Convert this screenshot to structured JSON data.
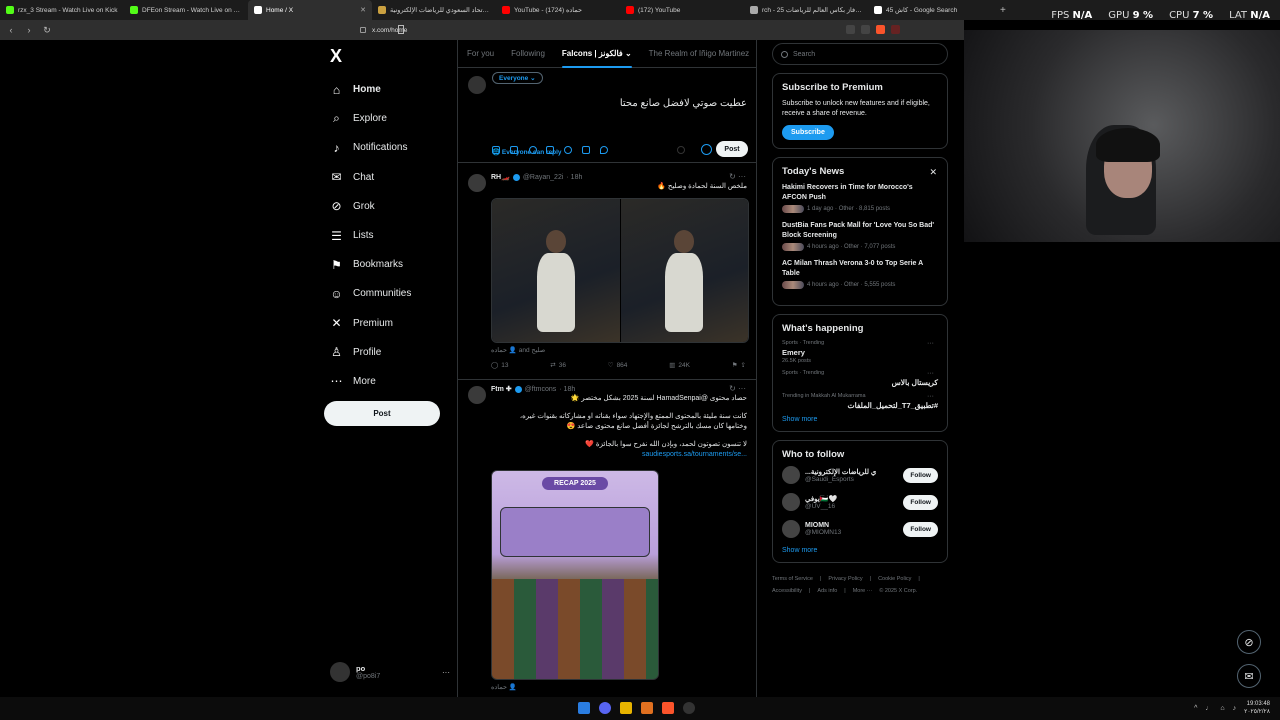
{
  "browser": {
    "tabs": [
      {
        "title": "rzx_3 Stream - Watch Live on Kick",
        "color": "#53fc18",
        "active": false
      },
      {
        "title": "DFEon Stream - Watch Live on Kick",
        "color": "#53fc18",
        "active": false
      },
      {
        "title": "Home / X",
        "color": "#ffffff",
        "active": true
      },
      {
        "title": "جوائز الاتحاد السعودي للرياضات الإلكترونية",
        "color": "#caa040",
        "active": false
      },
      {
        "title": "YouTube - حماده (1724)",
        "color": "#ff0000",
        "active": false
      },
      {
        "title": "(172) YouTube",
        "color": "#ff0000",
        "active": false
      },
      {
        "title": "rch - 25 مين فاز بكاس العالم للرياضات",
        "color": "#aaaaaa",
        "active": false
      },
      {
        "title": "كاش 45 - Google Search",
        "color": "#ffffff",
        "active": false
      }
    ],
    "url": "x.com/home"
  },
  "overlay": {
    "fps_label": "FPS",
    "fps": "N/A",
    "gpu_label": "GPU",
    "gpu": "9 %",
    "cpu_label": "CPU",
    "cpu": "7 %",
    "lat_label": "LAT",
    "lat": "N/A"
  },
  "nav": {
    "logo": "X",
    "items": [
      {
        "label": "Home",
        "icon": "home-icon",
        "glyph": "⌂"
      },
      {
        "label": "Explore",
        "icon": "search-icon",
        "glyph": "⌕"
      },
      {
        "label": "Notifications",
        "icon": "bell-icon",
        "glyph": "♪"
      },
      {
        "label": "Chat",
        "icon": "chat-icon",
        "glyph": "✉"
      },
      {
        "label": "Grok",
        "icon": "grok-icon",
        "glyph": "⊘"
      },
      {
        "label": "Lists",
        "icon": "list-icon",
        "glyph": "☰"
      },
      {
        "label": "Bookmarks",
        "icon": "bookmark-icon",
        "glyph": "⚑"
      },
      {
        "label": "Communities",
        "icon": "communities-icon",
        "glyph": "☺"
      },
      {
        "label": "Premium",
        "icon": "x-premium-icon",
        "glyph": "✕"
      },
      {
        "label": "Profile",
        "icon": "profile-icon",
        "glyph": "♙"
      },
      {
        "label": "More",
        "icon": "more-icon",
        "glyph": "⋯"
      }
    ],
    "post_label": "Post",
    "account": {
      "name": "po",
      "handle": "@po8i7"
    }
  },
  "timeline": {
    "tabs": [
      "For you",
      "Following",
      "Falcons | فالكونز",
      "The Realm of Iñigo Martinez"
    ],
    "composer": {
      "audience": "Everyone ⌄",
      "draft": "عطيت صوتي لافضل صانع محتا",
      "reply_setting": "🌐 Everyone can reply",
      "post_label": "Post"
    },
    "tweets": [
      {
        "name": "RH🏎️",
        "handle": "@Rayan_22i",
        "time": "· 18h",
        "text": "ملخص السنة لحمادة وصليح 🔥",
        "credit": "حماده 👤 and صليح",
        "replies": "13",
        "reposts": "36",
        "likes": "864",
        "views": "24K"
      },
      {
        "name": "Ftm ✚",
        "handle": "@ftmcons",
        "time": "· 18h",
        "lines": [
          "حصاد محتوى @HamadSenpai لسنة 2025 بشكل مختصر 🌟",
          "كانت سنة مليئة بالمحتوى الممتع والإجتهاد سواء بقناته او مشاركاته بقنوات غيره،",
          "وختامها كان مسك بالترشح لجائزة أفضل صانع محتوى صاعد 😍",
          "لا تنسون تصوتون لحمد، وبإذن الله نفرح سوا بالجائزة ❤️"
        ],
        "link": "saudiesports.sa/tournaments/se...",
        "badge": "RECAP 2025",
        "credit": "حماده 👤"
      }
    ]
  },
  "sidebar": {
    "search_placeholder": "Search",
    "premium": {
      "title": "Subscribe to Premium",
      "text": "Subscribe to unlock new features and if eligible, receive a share of revenue.",
      "button": "Subscribe"
    },
    "news": {
      "title": "Today's News",
      "items": [
        {
          "title": "Hakimi Recovers in Time for Morocco's AFCON Push",
          "meta": "1 day ago · Other · 8,815 posts"
        },
        {
          "title": "DustBia Fans Pack Mall for 'Love You So Bad' Block Screening",
          "meta": "4 hours ago · Other · 7,077 posts"
        },
        {
          "title": "AC Milan Thrash Verona 3-0 to Top Serie A Table",
          "meta": "4 hours ago · Other · 5,555 posts"
        }
      ]
    },
    "happening": {
      "title": "What's happening",
      "trends": [
        {
          "context": "Sports · Trending",
          "name": "Emery",
          "posts": "26.5K posts",
          "rtl": false
        },
        {
          "context": "Sports · Trending",
          "name": "كريستال بالاس",
          "posts": "",
          "rtl": true
        },
        {
          "context": "Trending in Makkah Al Mukarrama",
          "name": "#تطبيق_T7_لتحميل_الملفات",
          "posts": "",
          "rtl": true
        }
      ],
      "show_more": "Show more"
    },
    "follow": {
      "title": "Who to follow",
      "people": [
        {
          "name": "...ي للرياضات الإلكترونية",
          "handle": "@Saudi_Esports",
          "button": "Follow"
        },
        {
          "name": "يوفي🇵🇸🤍",
          "handle": "@UV__16",
          "button": "Follow"
        },
        {
          "name": "MIOMN",
          "handle": "@MIOMN13",
          "button": "Follow"
        }
      ],
      "show_more": "Show more"
    },
    "footer": [
      "Terms of Service",
      "|",
      "Privacy Policy",
      "|",
      "Cookie Policy",
      "|",
      "Accessibility",
      "|",
      "Ads info",
      "|",
      "More ···",
      "© 2025 X Corp."
    ]
  },
  "taskbar": {
    "time": "19:03:48",
    "date": "٢٠٢٥/٢/٢٨"
  }
}
